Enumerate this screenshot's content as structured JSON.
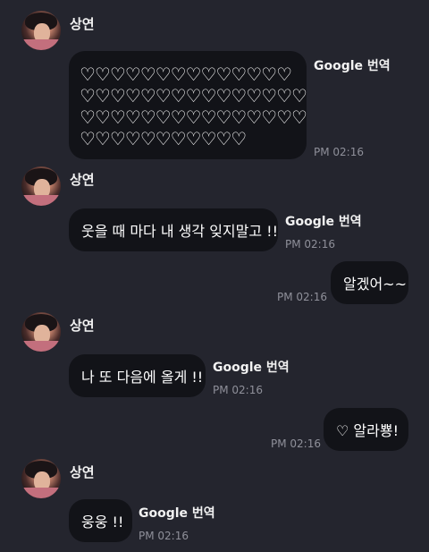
{
  "messages": [
    {
      "sender": "상연",
      "hearts": [
        "♡♡♡♡♡♡♡♡♡♡♡♡♡♡",
        "♡♡♡♡♡♡♡♡♡♡♡♡♡♡♡",
        "♡♡♡♡♡♡♡♡♡♡♡♡♡♡♡",
        "♡♡♡♡♡♡♡♡♡♡♡"
      ],
      "translate": "Google 번역",
      "time": "PM 02:16"
    },
    {
      "sender": "상연",
      "text": "웃을 때 마다 내 생각 잊지말고 !!",
      "translate": "Google 번역",
      "time": "PM 02:16"
    },
    {
      "outgoing": true,
      "text": "알겠어~~",
      "time": "PM 02:16"
    },
    {
      "sender": "상연",
      "text": "나 또 다음에 올게 !!",
      "translate": "Google 번역",
      "time": "PM 02:16"
    },
    {
      "outgoing": true,
      "text": "♡ 알라뿅!",
      "time": "PM 02:16"
    },
    {
      "sender": "상연",
      "text": "웅웅 !!",
      "translate": "Google 번역",
      "time": "PM 02:16"
    }
  ],
  "colors": {
    "background": "#24252e",
    "bubble": "#121318",
    "time": "#8f909a"
  }
}
